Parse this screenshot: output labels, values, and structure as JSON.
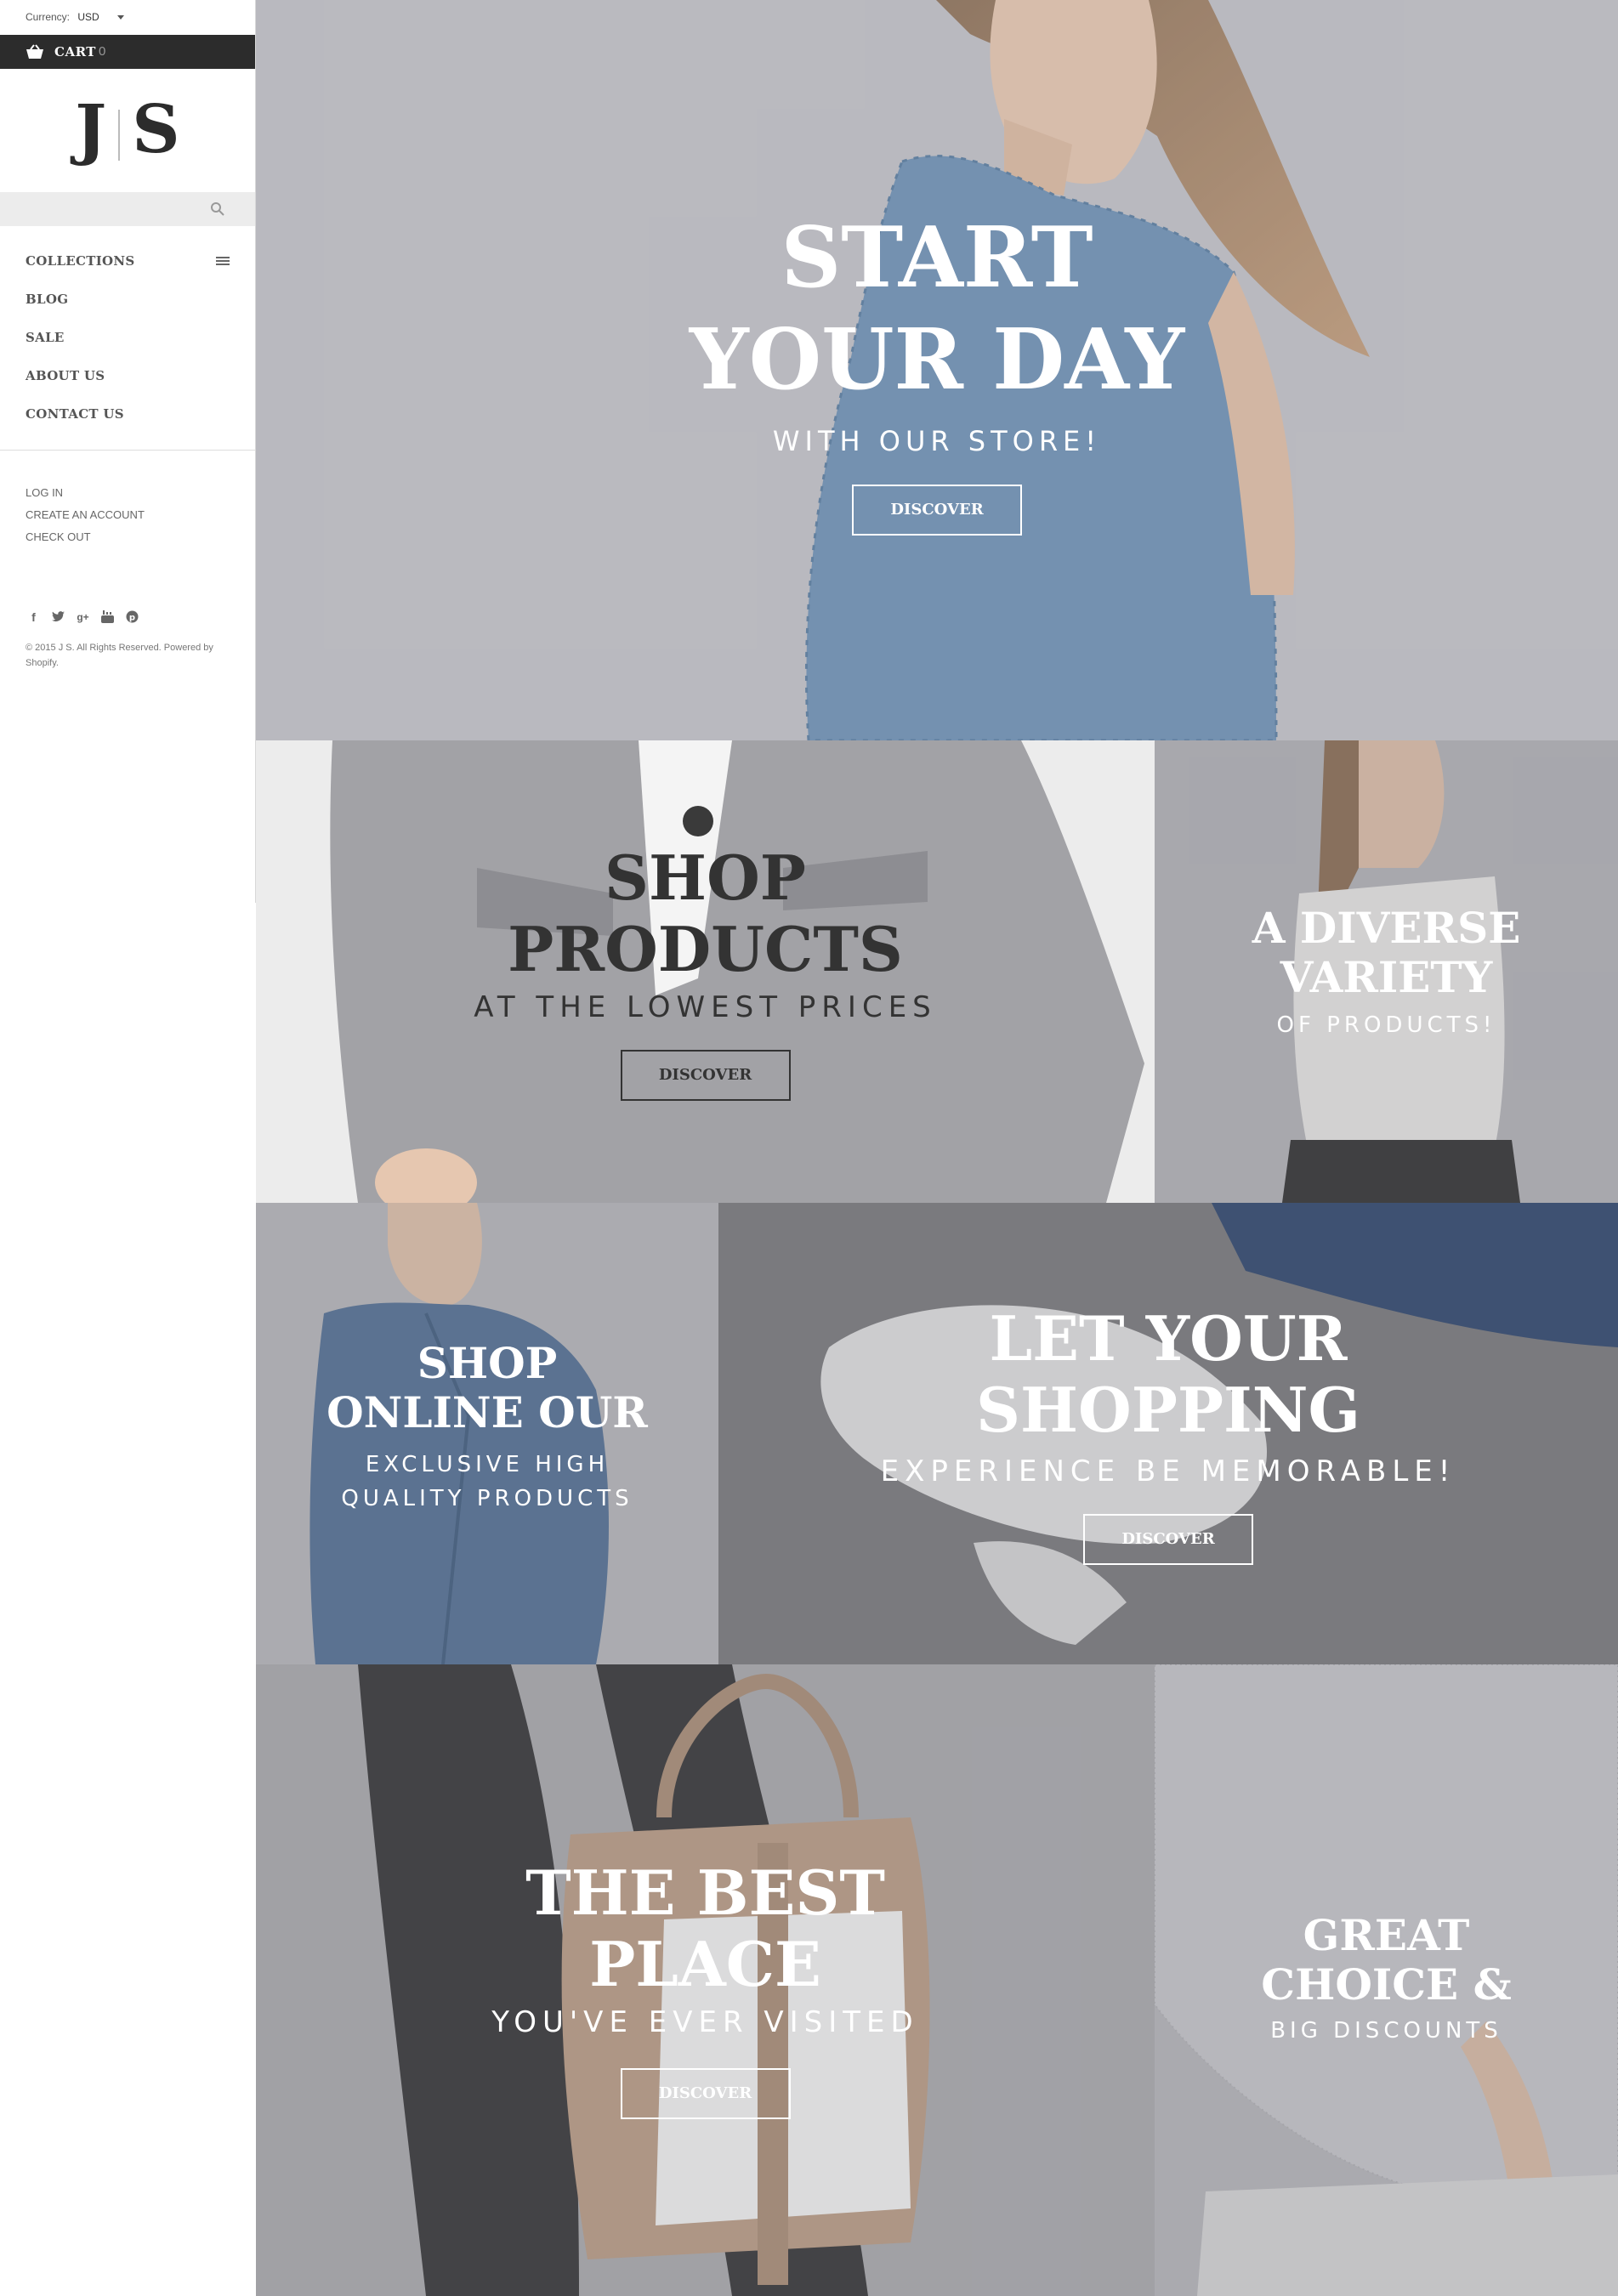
{
  "sidebar": {
    "currency_label": "Currency:",
    "currency_value": "USD",
    "cart_label": "CART",
    "cart_count": "0",
    "logo_left": "J",
    "logo_right": "S",
    "search_placeholder": "",
    "nav": [
      {
        "label": "COLLECTIONS"
      },
      {
        "label": "BLOG"
      },
      {
        "label": "SALE"
      },
      {
        "label": "ABOUT US"
      },
      {
        "label": "CONTACT US"
      }
    ],
    "account": [
      {
        "label": "LOG IN"
      },
      {
        "label": "CREATE AN ACCOUNT"
      },
      {
        "label": "CHECK OUT"
      }
    ],
    "social": [
      "facebook-icon",
      "twitter-icon",
      "google-plus-icon",
      "youtube-icon",
      "pinterest-icon"
    ],
    "copyright": "© 2015 J S. All Rights Reserved. Powered by Shopify."
  },
  "hero": {
    "title_line1": "START",
    "title_line2": "YOUR DAY",
    "subtitle": "WITH OUR STORE!",
    "button": "DISCOVER"
  },
  "tiles": {
    "shop_products": {
      "title_line1": "SHOP",
      "title_line2": "PRODUCTS",
      "subtitle": "AT THE LOWEST PRICES",
      "button": "DISCOVER"
    },
    "diverse": {
      "title_line1": "A DIVERSE",
      "title_line2": "VARIETY",
      "subtitle": "OF PRODUCTS!"
    },
    "online": {
      "title_line1": "SHOP",
      "title_line2": "ONLINE OUR",
      "subtitle_line1": "EXCLUSIVE HIGH",
      "subtitle_line2": "QUALITY PRODUCTS"
    },
    "shopping": {
      "title_line1": "LET YOUR",
      "title_line2": "SHOPPING",
      "subtitle": "EXPERIENCE BE MEMORABLE!",
      "button": "DISCOVER"
    },
    "best_place": {
      "title_line1": "THE BEST",
      "title_line2": "PLACE",
      "subtitle": "YOU'VE EVER VISITED",
      "button": "DISCOVER"
    },
    "great_choice": {
      "title_line1": "GREAT",
      "title_line2": "CHOICE &",
      "subtitle": "BIG DISCOUNTS"
    }
  },
  "colors": {
    "sidebar_cart_bg": "#2c2c2c",
    "text_dark": "#333333",
    "overlay_gray": "#a9a9ad"
  }
}
